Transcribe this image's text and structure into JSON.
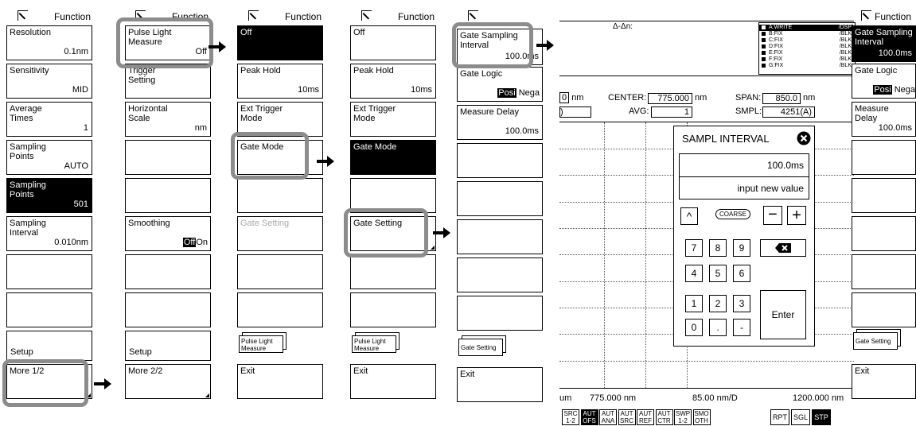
{
  "function_label": "Function",
  "panel1": {
    "resolution": {
      "label": "Resolution",
      "value": "0.1nm"
    },
    "sensitivity": {
      "label": "Sensitivity",
      "value": "MID"
    },
    "average_times": {
      "label1": "Average",
      "label2": "Times",
      "value": "1"
    },
    "sampling_points_auto": {
      "label1": "Sampling",
      "label2": "Points",
      "value": "AUTO"
    },
    "sampling_points": {
      "label1": "Sampling",
      "label2": "Points",
      "value": "501"
    },
    "sampling_interval": {
      "label1": "Sampling",
      "label2": "Interval",
      "value": "0.010nm"
    },
    "setup": "Setup",
    "more": "More 1/2"
  },
  "panel2": {
    "pulse_light": {
      "label1": "Pulse Light",
      "label2": "Measure",
      "value": "Off"
    },
    "trigger": {
      "label1": "Trigger",
      "label2": "Setting"
    },
    "horizontal": {
      "label1": "Horizontal",
      "label2": "Scale",
      "value": "nm"
    },
    "smoothing": {
      "label": "Smoothing",
      "off": "Off",
      "on": "On"
    },
    "setup": "Setup",
    "more": "More 2/2"
  },
  "panel3": {
    "off": "Off",
    "peak_hold": {
      "label": "Peak Hold",
      "value": "10ms"
    },
    "ext_trigger": {
      "label1": "Ext Trigger",
      "label2": "Mode"
    },
    "gate_mode": "Gate Mode",
    "gate_setting": "Gate Setting",
    "pulse_light_stack": {
      "label1": "Pulse Light",
      "label2": "Measure"
    },
    "exit": "Exit"
  },
  "panel4": {
    "off": "Off",
    "peak_hold": {
      "label": "Peak Hold",
      "value": "10ms"
    },
    "ext_trigger": {
      "label1": "Ext Trigger",
      "label2": "Mode"
    },
    "gate_mode": "Gate Mode",
    "gate_setting": "Gate Setting",
    "pulse_light_stack": {
      "label1": "Pulse Light",
      "label2": "Measure"
    },
    "exit": "Exit"
  },
  "panel5": {
    "gate_sampling": {
      "label1": "Gate Sampling",
      "label2": "Interval",
      "value": "100.0ms"
    },
    "gate_logic": {
      "label": "Gate Logic",
      "posi": "Posi",
      "nega": "Nega"
    },
    "measure_delay": {
      "label": "Measure Delay",
      "value": "100.0ms"
    },
    "gate_setting_stack": "Gate Setting",
    "exit": "Exit"
  },
  "screen": {
    "delta": "Δ-Δn:",
    "legend": [
      {
        "name": "A:WRITE",
        "mode": "/DSP"
      },
      {
        "name": "B:FIX",
        "mode": "/BLK"
      },
      {
        "name": "C:FIX",
        "mode": "/BLK"
      },
      {
        "name": "D:FIX",
        "mode": "/BLK"
      },
      {
        "name": "E:FIX",
        "mode": "/BLK"
      },
      {
        "name": "F:FIX",
        "mode": "/BLK"
      },
      {
        "name": "G:FIX",
        "mode": "/BLK"
      }
    ],
    "left_field": "0",
    "nm1": "nm",
    "center_label": "CENTER:",
    "center_value": "775.000",
    "nm2": "nm",
    "span_label": "SPAN:",
    "span_value": "850.0",
    "nm3": "nm",
    "left_field2": ")",
    "avg_label": "AVG:",
    "avg_value": "1",
    "smpl_label": "SMPL:",
    "smpl_value": "4251(A)",
    "bottom_left": "um",
    "bottom_center": "775.000 nm",
    "bottom_div": "85.00 nm/D",
    "bottom_right": "1200.000 nm"
  },
  "dialog": {
    "title": "SAMPL INTERVAL",
    "value": "100.0ms",
    "hint": "input new value",
    "coarse": "COARSE",
    "keys": [
      "7",
      "8",
      "9",
      "4",
      "5",
      "6",
      "1",
      "2",
      "3",
      "0",
      ".",
      "-"
    ],
    "enter": "Enter"
  },
  "toolbar": [
    {
      "l1": "SRC",
      "l2": "1-2",
      "on": false
    },
    {
      "l1": "AUT",
      "l2": "OFS",
      "on": true
    },
    {
      "l1": "AUT",
      "l2": "ANA",
      "on": false
    },
    {
      "l1": "AUT",
      "l2": "SRC",
      "on": false
    },
    {
      "l1": "AUT",
      "l2": "REF",
      "on": false
    },
    {
      "l1": "AUT",
      "l2": "CTR",
      "on": false
    },
    {
      "l1": "SWP",
      "l2": "1-2",
      "on": false
    },
    {
      "l1": "SMO",
      "l2": "OTH",
      "on": false
    }
  ],
  "toolbar_right": [
    {
      "label": "RPT",
      "on": false
    },
    {
      "label": "SGL",
      "on": false
    },
    {
      "label": "STP",
      "on": true
    }
  ],
  "panel6": {
    "gate_sampling": {
      "label1": "Gate Sampling",
      "label2": "Interval",
      "value": "100.0ms"
    },
    "gate_logic": {
      "label": "Gate Logic",
      "posi": "Posi",
      "nega": "Nega"
    },
    "measure_delay": {
      "label": "Measure Delay",
      "value": "100.0ms"
    },
    "gate_setting_stack": "Gate Setting",
    "exit": "Exit"
  }
}
